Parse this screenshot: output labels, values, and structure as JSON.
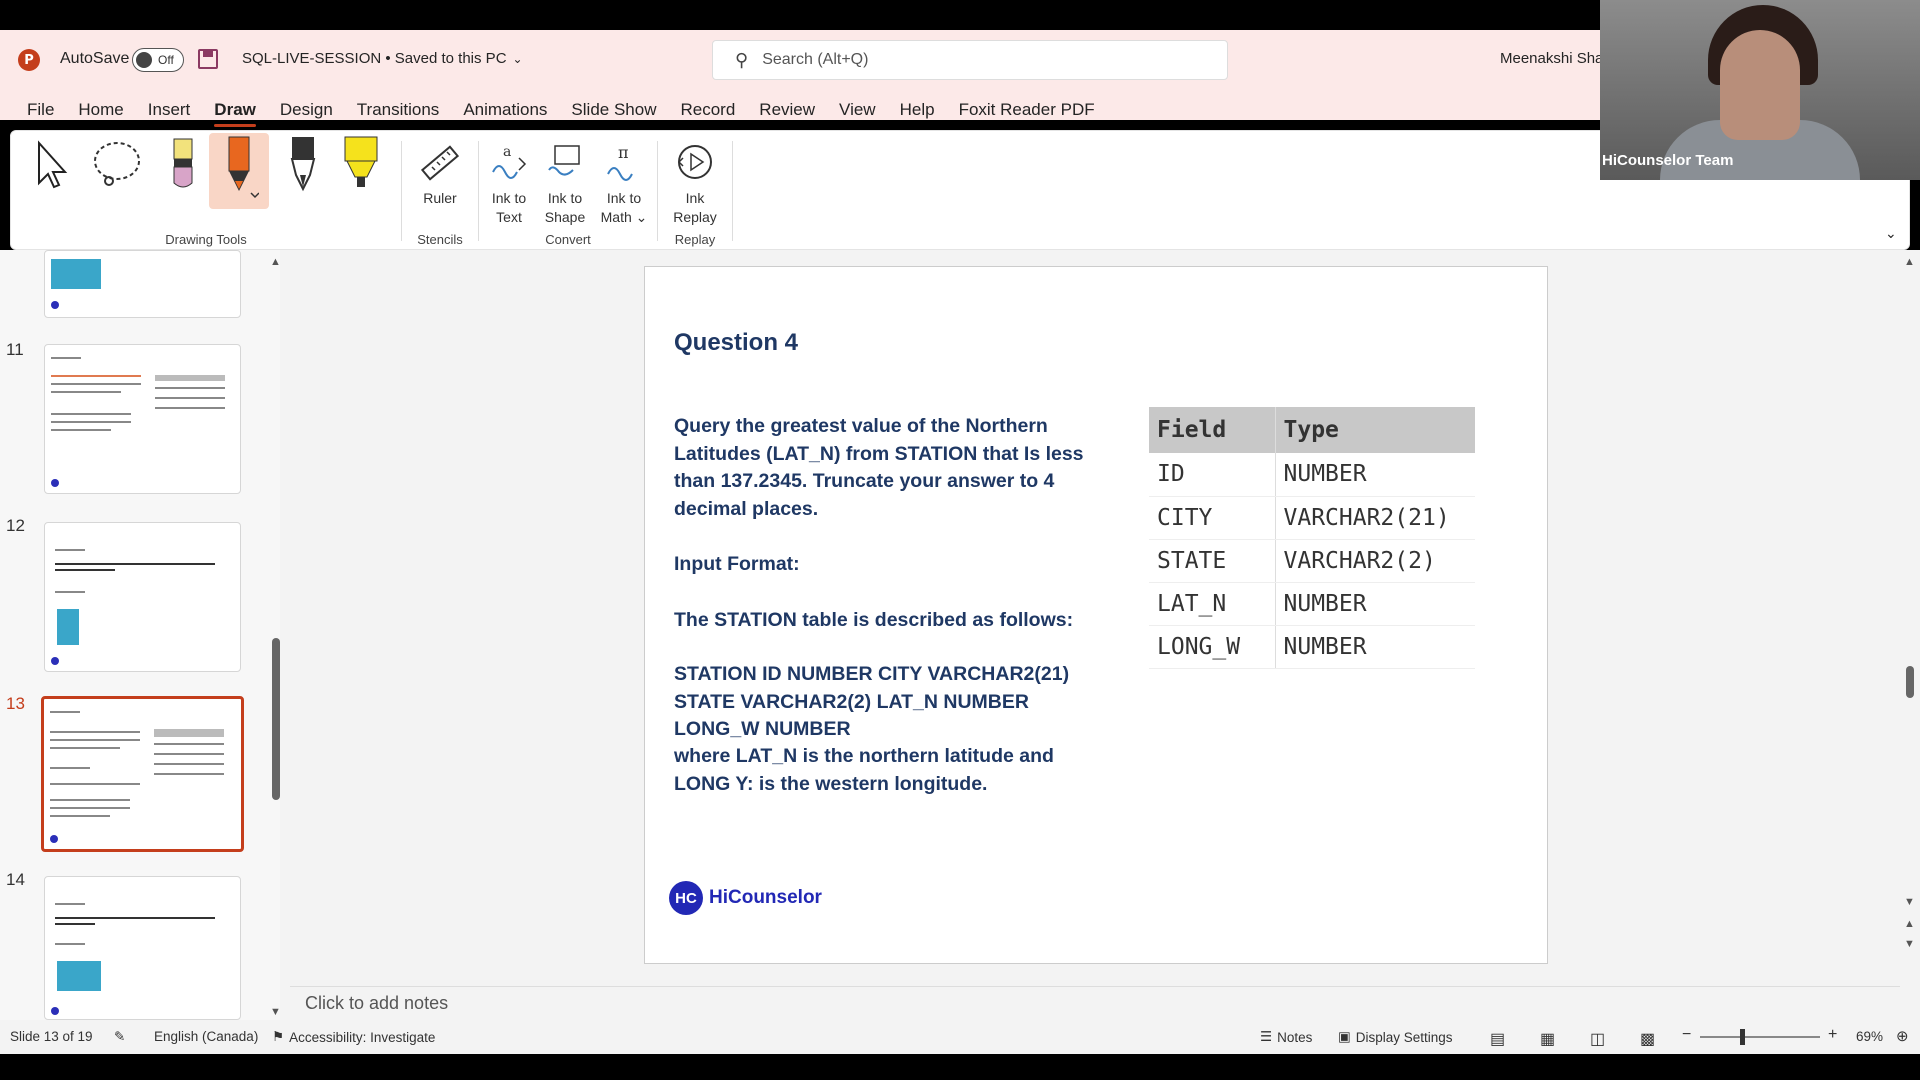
{
  "titlebar": {
    "app_icon": "powerpoint-icon",
    "autosave_label": "AutoSave",
    "autosave_state": "Off",
    "document_title": "SQL-LIVE-SESSION • Saved to this PC",
    "search_placeholder": "Search (Alt+Q)",
    "user_name": "Meenakshi Shar"
  },
  "tabs": [
    {
      "label": "File"
    },
    {
      "label": "Home"
    },
    {
      "label": "Insert"
    },
    {
      "label": "Draw"
    },
    {
      "label": "Design"
    },
    {
      "label": "Transitions"
    },
    {
      "label": "Animations"
    },
    {
      "label": "Slide Show"
    },
    {
      "label": "Record"
    },
    {
      "label": "Review"
    },
    {
      "label": "View"
    },
    {
      "label": "Help"
    },
    {
      "label": "Foxit Reader PDF"
    }
  ],
  "ribbon": {
    "groups": {
      "drawing_tools": "Drawing Tools",
      "stencils": "Stencils",
      "convert": "Convert",
      "replay": "Replay"
    },
    "buttons": {
      "ruler": "Ruler",
      "ink_to_text_1": "Ink to",
      "ink_to_text_2": "Text",
      "ink_to_shape_1": "Ink to",
      "ink_to_shape_2": "Shape",
      "ink_to_math_1": "Ink to",
      "ink_to_math_2": "Math",
      "ink_replay_1": "Ink",
      "ink_replay_2": "Replay"
    },
    "colors": {
      "pencil_yellow": "#f2e27c",
      "pen_orange": "#e8671f",
      "highlighter_yellow": "#f5e21c",
      "accent": "#c43e1c"
    }
  },
  "webcam": {
    "label": "HiCounselor Team"
  },
  "thumbnails": [
    {
      "number": "11"
    },
    {
      "number": "12"
    },
    {
      "number": "13",
      "selected": true
    },
    {
      "number": "14"
    }
  ],
  "slide": {
    "title": "Question 4",
    "paragraph1": "Query the greatest value of the Northern Latitudes (LAT_N) from STATION that Is less than 137.2345. Truncate your answer to 4 decimal places.",
    "input_format": "Input Format:",
    "station_desc": "The STATION table is described as follows:",
    "station_schema": "STATION ID NUMBER CITY VARCHAR2(21) STATE VARCHAR2(2) LAT_N NUMBER LONG_W NUMBER",
    "where_clause": "where LAT_N is the northern latitude and LONG Y: is the western longitude.",
    "table": {
      "headers": [
        "Field",
        "Type"
      ],
      "rows": [
        [
          "ID",
          "NUMBER"
        ],
        [
          "CITY",
          "VARCHAR2(21)"
        ],
        [
          "STATE",
          "VARCHAR2(2)"
        ],
        [
          "LAT_N",
          "NUMBER"
        ],
        [
          "LONG_W",
          "NUMBER"
        ]
      ]
    },
    "logo_mark": "HC",
    "logo_text": "HiCounselor"
  },
  "notes_placeholder": "Click to add notes",
  "statusbar": {
    "slide_count": "Slide 13 of 19",
    "language": "English (Canada)",
    "accessibility": "Accessibility: Investigate",
    "notes": "Notes",
    "display_settings": "Display Settings",
    "zoom": "69%"
  }
}
